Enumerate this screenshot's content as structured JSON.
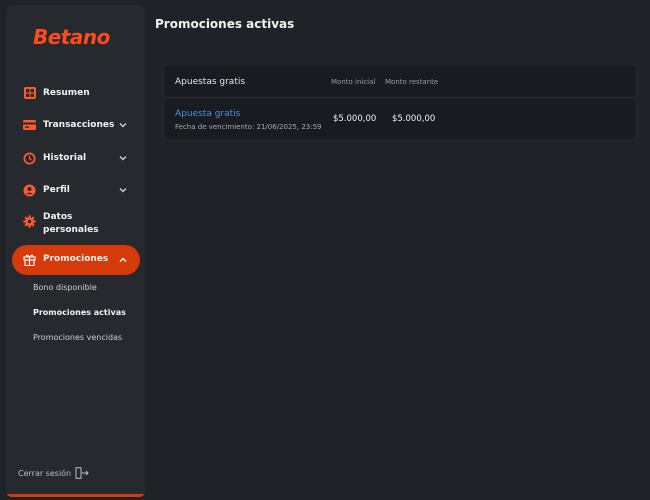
{
  "brand": {
    "logo_text": "Betano",
    "accent": "#d63a0b",
    "logo_color": "#ff4a1b"
  },
  "sidebar": {
    "items": [
      {
        "label": "Resumen",
        "icon": "grid-icon",
        "expandable": false
      },
      {
        "label": "Transacciones",
        "icon": "card-icon",
        "expandable": true
      },
      {
        "label": "Historial",
        "icon": "history-icon",
        "expandable": true
      },
      {
        "label": "Perfil",
        "icon": "user-icon",
        "expandable": true
      },
      {
        "label_line1": "Datos",
        "label_line2": "personales",
        "icon": "gear-icon",
        "expandable": false
      },
      {
        "label": "Promociones",
        "icon": "gift-icon",
        "expandable": true,
        "active": true
      }
    ],
    "subitems": [
      {
        "label": "Bono disponible",
        "active": false
      },
      {
        "label": "Promociones activas",
        "active": true
      },
      {
        "label": "Promociones vencidas",
        "active": false
      }
    ],
    "logout_label": "Cerrar sesión"
  },
  "main": {
    "title": "Promociones activas",
    "table": {
      "headers": {
        "name": "Apuestas gratis",
        "initial": "Monto inicial",
        "remaining": "Monto restante"
      },
      "rows": [
        {
          "name": "Apuesta gratis",
          "expiry": "Fecha de vencimiento: 21/06/2025, 23:59",
          "initial": "$5.000,00",
          "remaining": "$5.000,00"
        }
      ]
    }
  }
}
